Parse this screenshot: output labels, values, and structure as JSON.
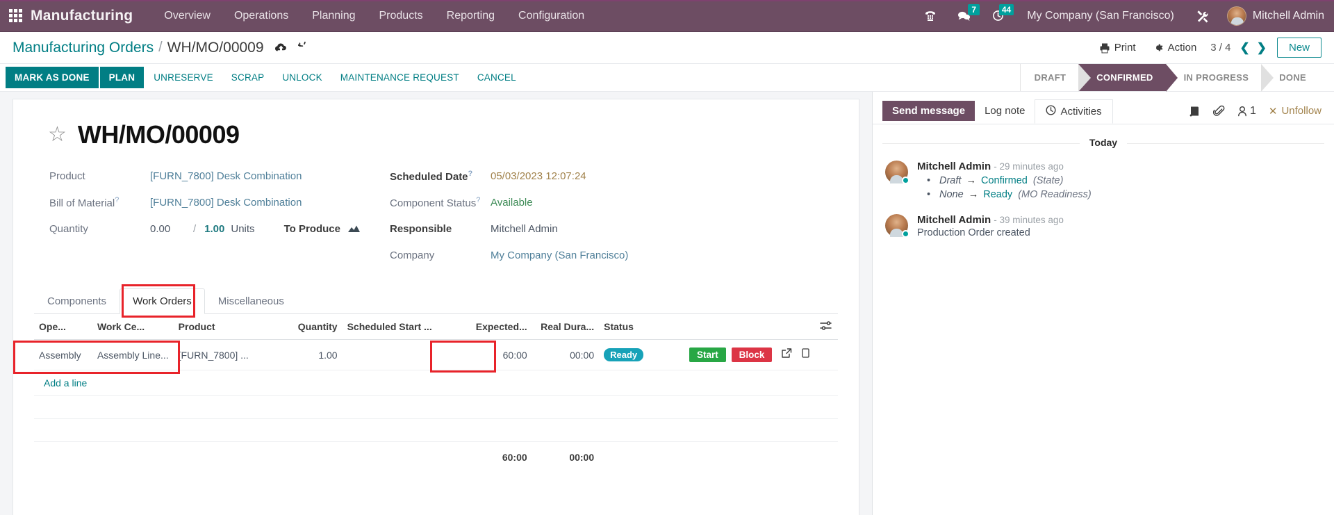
{
  "navbar": {
    "apps_icon": "grid-apps-icon",
    "brand": "Manufacturing",
    "menus": [
      "Overview",
      "Operations",
      "Planning",
      "Products",
      "Reporting",
      "Configuration"
    ],
    "sysicons": [
      {
        "name": "voip-phone-icon",
        "glyph": "☎",
        "badge": ""
      },
      {
        "name": "messages-icon",
        "glyph": "💬",
        "badge": "7"
      },
      {
        "name": "activities-clock-icon",
        "glyph": "◴",
        "badge": "44"
      }
    ],
    "company": "My Company (San Francisco)",
    "debug_icon": "tools-wrench-icon",
    "user": "Mitchell Admin"
  },
  "control_panel": {
    "breadcrumb_root": "Manufacturing Orders",
    "breadcrumb_sep": "/",
    "breadcrumb_current": "WH/MO/00009",
    "save_icon": "cloud-upload-save-icon",
    "discard_icon": "undo-discard-icon",
    "print_label": "Print",
    "action_label": "Action",
    "pager": "3 / 4",
    "prev_icon": "chevron-left-icon",
    "next_icon": "chevron-right-icon",
    "new_label": "New"
  },
  "statusbar": {
    "buttons": [
      {
        "label": "MARK AS DONE",
        "style": "primary"
      },
      {
        "label": "PLAN",
        "style": "primary"
      },
      {
        "label": "UNRESERVE",
        "style": "plain"
      },
      {
        "label": "SCRAP",
        "style": "plain"
      },
      {
        "label": "UNLOCK",
        "style": "plain"
      },
      {
        "label": "MAINTENANCE REQUEST",
        "style": "plain"
      },
      {
        "label": "CANCEL",
        "style": "plain"
      }
    ],
    "stages": [
      {
        "label": "DRAFT",
        "active": false
      },
      {
        "label": "CONFIRMED",
        "active": true
      },
      {
        "label": "IN PROGRESS",
        "active": false
      },
      {
        "label": "DONE",
        "active": false
      }
    ]
  },
  "form": {
    "star_icon": "favorite-star-icon",
    "title": "WH/MO/00009",
    "left_fields": [
      {
        "label": "Product",
        "help": false,
        "value": "[FURN_7800] Desk Combination",
        "kind": "link"
      },
      {
        "label": "Bill of Material",
        "help": true,
        "value": "[FURN_7800] Desk Combination",
        "kind": "link"
      }
    ],
    "quantity": {
      "label": "Quantity",
      "done": "0.00",
      "separator": "/",
      "total": "1.00",
      "uom": "Units",
      "to_produce_label": "To Produce",
      "to_produce_icon": "forecast-chart-icon"
    },
    "right_fields": [
      {
        "label": "Scheduled Date",
        "help": true,
        "value": "05/03/2023 12:07:24",
        "kind": "date",
        "bold": true
      },
      {
        "label": "Component Status",
        "help": true,
        "value": "Available",
        "kind": "green",
        "bold": false
      },
      {
        "label": "Responsible",
        "help": false,
        "value": "Mitchell Admin",
        "kind": "plain",
        "bold": true
      },
      {
        "label": "Company",
        "help": false,
        "value": "My Company (San Francisco)",
        "kind": "link",
        "bold": false
      }
    ]
  },
  "notebook": {
    "tabs": [
      {
        "label": "Components",
        "active": false
      },
      {
        "label": "Work Orders",
        "active": true,
        "highlighted": true
      },
      {
        "label": "Miscellaneous",
        "active": false
      }
    ],
    "optional_columns_icon": "column-settings-icon",
    "columns": [
      "Ope...",
      "Work Ce...",
      "Product",
      "Quantity",
      "Scheduled Start ...",
      "Expected...",
      "Real Dura...",
      "Status"
    ],
    "rows": [
      {
        "operation": "Assembly",
        "work_center": "Assembly Line...",
        "product": "[FURN_7800] ...",
        "quantity": "1.00",
        "scheduled_start": "",
        "expected_duration": "60:00",
        "real_duration": "00:00",
        "status": "Ready",
        "start_label": "Start",
        "block_label": "Block",
        "open_icon": "external-link-icon",
        "copy_icon": "duplicate-icon",
        "highlighted": true,
        "expected_highlighted": true
      }
    ],
    "add_line_label": "Add a line",
    "totals": {
      "expected": "60:00",
      "real": "00:00"
    }
  },
  "chatter": {
    "send_message_label": "Send message",
    "log_note_label": "Log note",
    "activities_label": "Activities",
    "activities_icon": "clock-icon",
    "tools": [
      {
        "name": "knowledge-book-icon",
        "glyph": "📕",
        "count": ""
      },
      {
        "name": "attachment-paperclip-icon",
        "glyph": "📎",
        "count": ""
      },
      {
        "name": "followers-user-icon",
        "glyph": "👤",
        "count": "1"
      }
    ],
    "unfollow_label": "Unfollow",
    "unfollow_icon": "close-x-icon",
    "today_label": "Today",
    "messages": [
      {
        "author": "Mitchell Admin",
        "time": "- 29 minutes ago",
        "tracking": [
          {
            "old": "Draft",
            "arrow": "→",
            "new": "Confirmed",
            "field": "(State)"
          },
          {
            "old": "None",
            "arrow": "→",
            "new": "Ready",
            "field": "(MO Readiness)"
          }
        ],
        "text": ""
      },
      {
        "author": "Mitchell Admin",
        "time": "- 39 minutes ago",
        "tracking": [],
        "text": "Production Order created"
      }
    ]
  },
  "colors": {
    "brand_purple": "#6d4d63",
    "teal": "#017e84",
    "highlight_red": "#e8232a",
    "badge_teal": "#00a09d",
    "ready_cyan": "#17a2b8",
    "start_green": "#28a745",
    "block_red": "#dc3545"
  }
}
